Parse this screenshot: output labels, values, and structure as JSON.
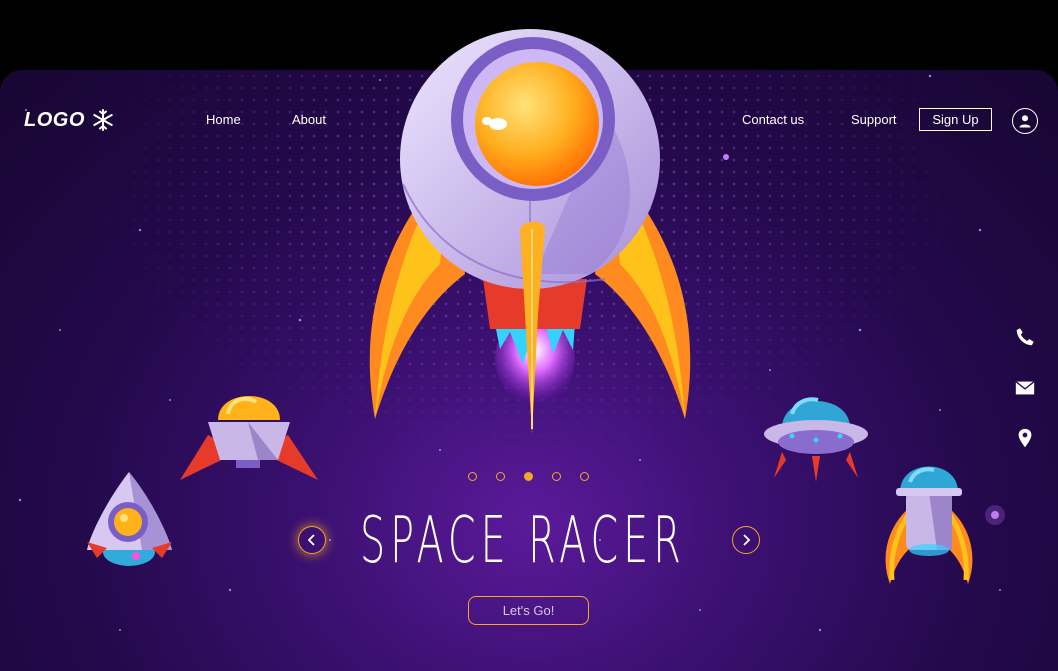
{
  "header": {
    "logo_text": "LOGO",
    "nav": {
      "home": "Home",
      "about": "About",
      "contact": "Contact us",
      "support": "Support"
    },
    "signup_label": "Sign Up"
  },
  "side_icons": [
    "phone-icon",
    "mail-icon",
    "location-icon"
  ],
  "carousel": {
    "slides": 5,
    "active_index": 2
  },
  "hero": {
    "title": "SPACE RACER",
    "cta_label": "Let's Go!"
  },
  "colors": {
    "accent": "#f5a623",
    "background": "#2a0b57",
    "text": "#ffffff"
  }
}
